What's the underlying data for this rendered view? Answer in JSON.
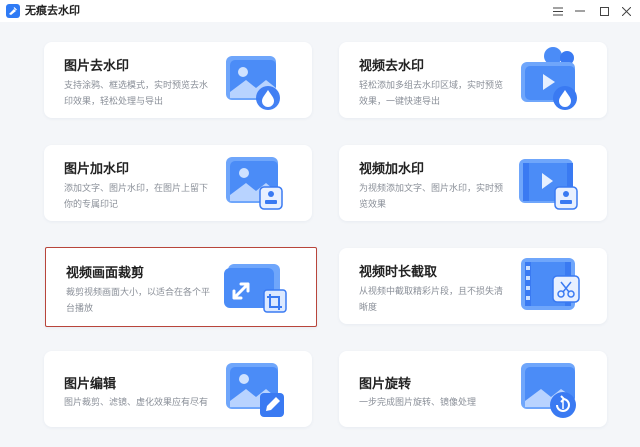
{
  "window": {
    "title": "无痕去水印",
    "menu_icon": "hamburger-menu-icon",
    "minimize_icon": "minimize-icon",
    "maximize_icon": "maximize-icon",
    "close_icon": "close-icon"
  },
  "cards": [
    {
      "title": "图片去水印",
      "desc_line1": "支持涂鸦、框选模式，实时预览去水",
      "desc_line2": "印效果，轻松处理与导出",
      "icon": "image-droplet-icon"
    },
    {
      "title": "视频去水印",
      "desc_line1": "轻松添加多组去水印区域，实时预览",
      "desc_line2": "效果，一键快速导出",
      "icon": "video-droplet-icon"
    },
    {
      "title": "图片加水印",
      "desc_line1": "添加文字、图片水印，在图片上留下",
      "desc_line2": "你的专属印记",
      "icon": "image-stamp-icon"
    },
    {
      "title": "视频加水印",
      "desc_line1": "为视频添加文字、图片水印，实时预",
      "desc_line2": "览效果",
      "icon": "video-stamp-icon"
    },
    {
      "title": "视频画面裁剪",
      "desc_line1": "裁剪视频画面大小，以适合在各个平",
      "desc_line2": "台播放",
      "icon": "video-crop-icon"
    },
    {
      "title": "视频时长截取",
      "desc_line1": "从视频中截取精彩片段，且不损失清",
      "desc_line2": "晰度",
      "icon": "film-scissors-icon"
    },
    {
      "title": "图片编辑",
      "desc_line1": "图片裁剪、滤镜、虚化效果应有尽有",
      "desc_line2": "",
      "icon": "image-edit-icon"
    },
    {
      "title": "图片旋转",
      "desc_line1": "一步完成图片旋转、镜像处理",
      "desc_line2": "",
      "icon": "image-rotate-icon"
    }
  ],
  "colors": {
    "accent": "#2f7bf5",
    "selected_border": "#b8453b",
    "background": "#f4f6f9"
  }
}
